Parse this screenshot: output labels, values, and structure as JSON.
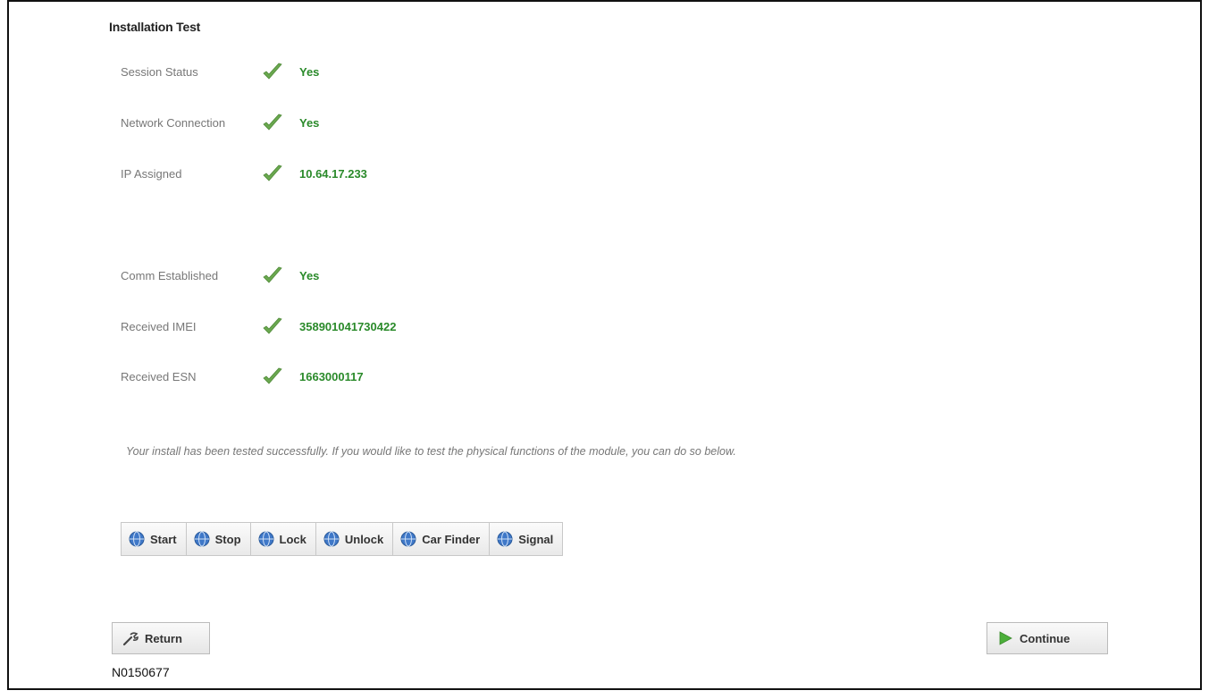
{
  "page": {
    "title": "Installation Test",
    "doc_id": "N0150677"
  },
  "checks": [
    {
      "label": "Session Status",
      "value": "Yes",
      "icon": "checkmark-icon"
    },
    {
      "label": "Network Connection",
      "value": "Yes",
      "icon": "checkmark-icon"
    },
    {
      "label": "IP Assigned",
      "value": "10.64.17.233",
      "icon": "checkmark-icon"
    },
    {
      "label": "Comm Established",
      "value": "Yes",
      "icon": "checkmark-icon"
    },
    {
      "label": "Received IMEI",
      "value": "358901041730422",
      "icon": "checkmark-icon"
    },
    {
      "label": "Received ESN",
      "value": "1663000117",
      "icon": "checkmark-icon"
    }
  ],
  "message": "Your install has been tested successfully. If you would like to test the physical functions of the module, you can do so below.",
  "function_buttons": [
    {
      "label": "Start",
      "icon": "globe-icon"
    },
    {
      "label": "Stop",
      "icon": "globe-icon"
    },
    {
      "label": "Lock",
      "icon": "globe-icon"
    },
    {
      "label": "Unlock",
      "icon": "globe-icon"
    },
    {
      "label": "Car Finder",
      "icon": "globe-icon"
    },
    {
      "label": "Signal",
      "icon": "globe-icon"
    }
  ],
  "nav": {
    "return_label": "Return",
    "return_icon": "wrench-icon",
    "continue_label": "Continue",
    "continue_icon": "play-arrow-icon"
  },
  "colors": {
    "value_green": "#2a8a2a",
    "check_green": "#5a9a3a",
    "label_gray": "#777777"
  }
}
